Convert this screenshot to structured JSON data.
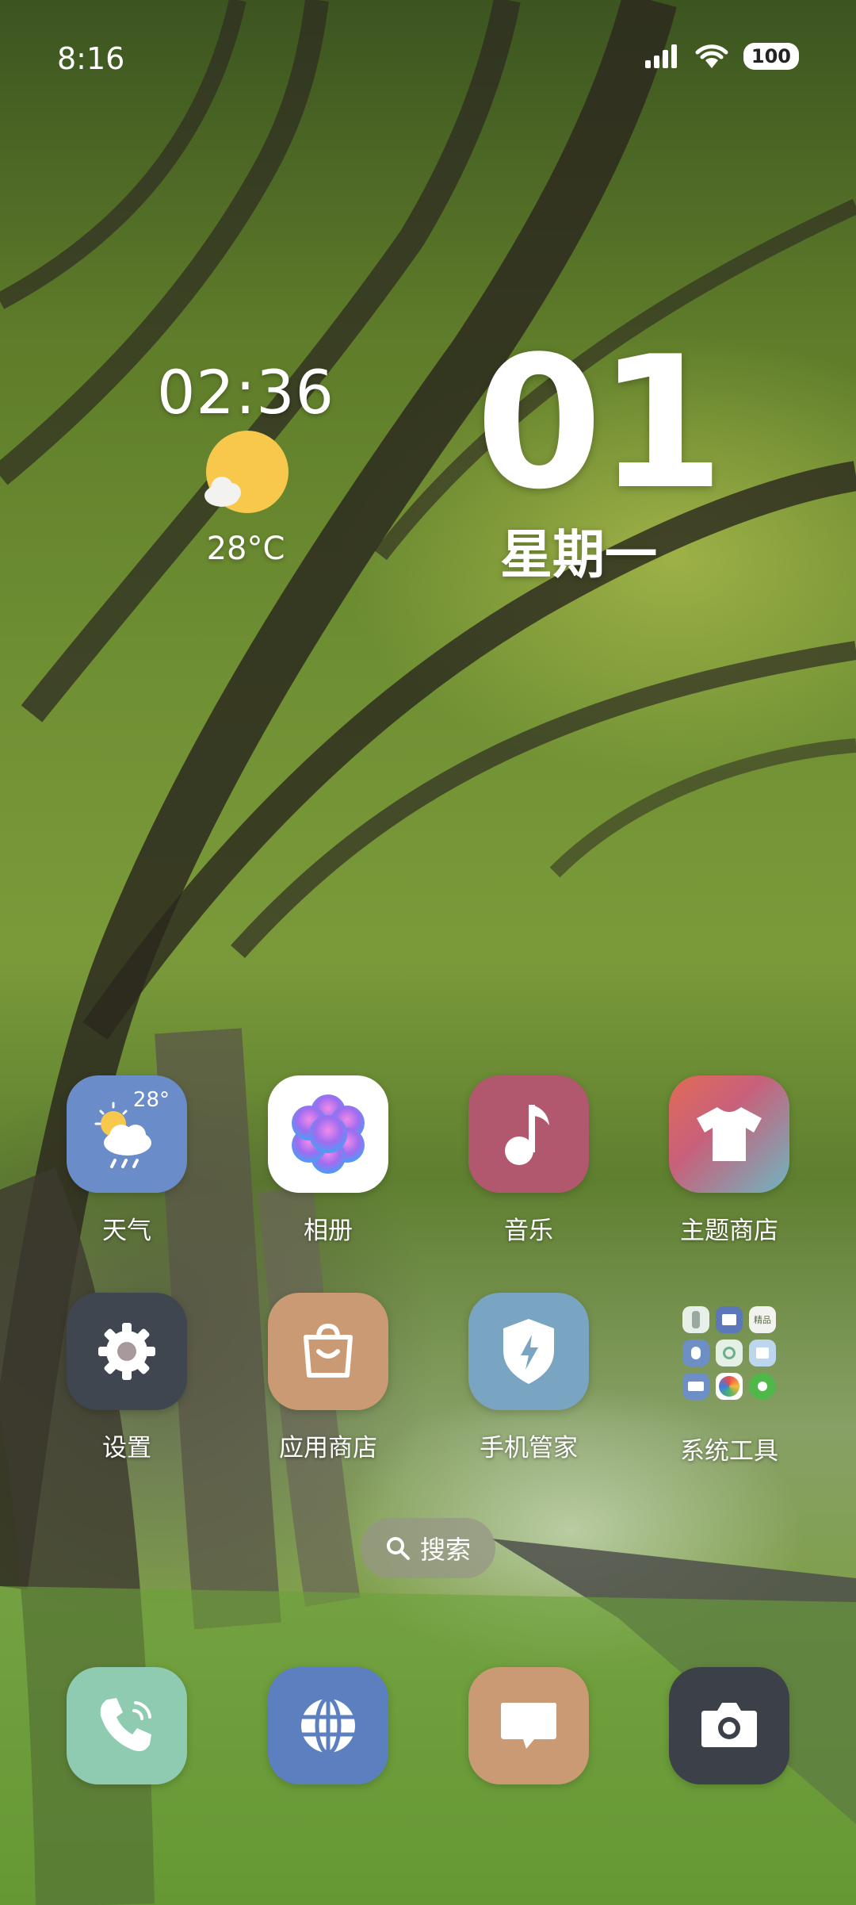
{
  "status_bar": {
    "time": "8:16",
    "battery": "100",
    "icons": [
      "signal-icon",
      "wifi-icon",
      "battery-icon"
    ]
  },
  "clock_widget": {
    "time": "02:36",
    "temperature": "28°C",
    "weather_icon": "sunny-partly-cloudy-icon"
  },
  "date_widget": {
    "day": "01",
    "weekday": "星期一"
  },
  "apps_row1": [
    {
      "name": "天气",
      "icon": "weather-icon",
      "badge": "28°",
      "color": "#6a8cc8"
    },
    {
      "name": "相册",
      "icon": "gallery-flower-icon",
      "color": "#ffffff"
    },
    {
      "name": "音乐",
      "icon": "music-note-icon",
      "color": "#b2586e"
    },
    {
      "name": "主题商店",
      "icon": "tshirt-icon",
      "color": "#e0705a"
    }
  ],
  "apps_row2": [
    {
      "name": "设置",
      "icon": "gear-icon",
      "color": "#3f4650"
    },
    {
      "name": "应用商店",
      "icon": "shopping-bag-icon",
      "color": "#c99a74"
    },
    {
      "name": "手机管家",
      "icon": "shield-bolt-icon",
      "color": "#79a5c2"
    },
    {
      "name": "系统工具",
      "icon": "folder-icon",
      "folder_items": [
        "remote-icon",
        "book-icon",
        "精品",
        "hand-icon",
        "sync-icon",
        "grid-icon",
        "card-icon",
        "browser-icon",
        "green-dot-icon"
      ]
    }
  ],
  "search": {
    "label": "搜索",
    "icon": "search-icon"
  },
  "dock": [
    {
      "icon": "phone-icon",
      "color": "#8fcbb0"
    },
    {
      "icon": "globe-icon",
      "color": "#5c7fc0"
    },
    {
      "icon": "message-icon",
      "color": "#c99a74"
    },
    {
      "icon": "camera-icon",
      "color": "#3c4048"
    }
  ]
}
